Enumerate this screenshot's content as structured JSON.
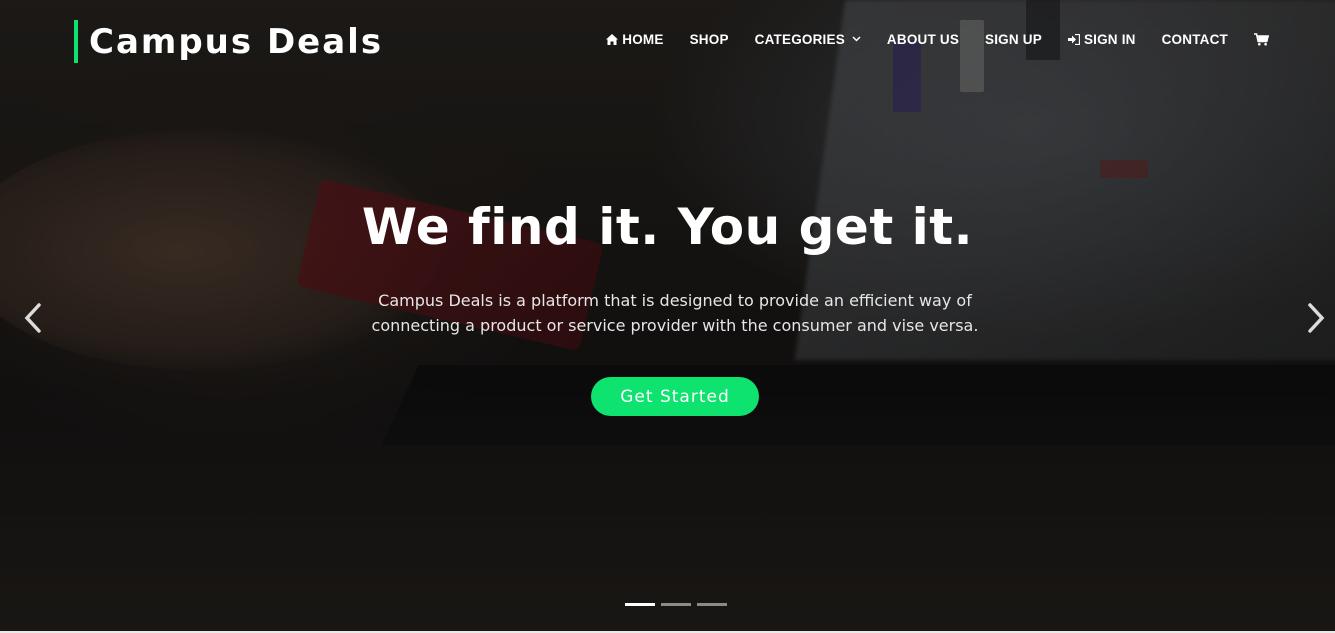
{
  "brand": {
    "name": "Campus Deals",
    "accent_color": "#0ee36f"
  },
  "nav": {
    "items": [
      {
        "label": "HOME",
        "icon": "home-icon"
      },
      {
        "label": "SHOP"
      },
      {
        "label": "CATEGORIES",
        "dropdown": true
      },
      {
        "label": "ABOUT US"
      },
      {
        "label": "SIGN UP"
      },
      {
        "label": "SIGN IN",
        "icon": "sign-in-icon"
      },
      {
        "label": "CONTACT"
      }
    ],
    "cart_icon": "cart-icon"
  },
  "hero": {
    "title": "We find it. You get it.",
    "description": "Campus Deals is a platform that is designed to provide an efficient way of connecting a product or service provider with the consumer and vise versa.",
    "cta_label": "Get Started",
    "cta_color": "#0ee36f"
  },
  "carousel": {
    "prev_icon": "chevron-left-icon",
    "next_icon": "chevron-right-icon",
    "slide_count": 3,
    "active_slide": 1
  }
}
